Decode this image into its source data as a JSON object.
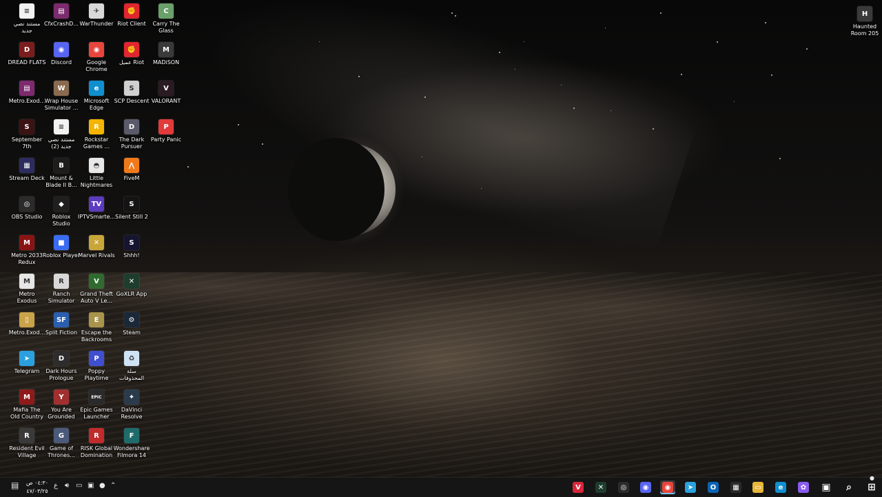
{
  "desktop": {
    "icons": [
      {
        "label": "مستند نصي\nجديد",
        "icon": "text-document-icon",
        "color": "#f2f2f2",
        "glyph": "≡"
      },
      {
        "label": "DREAD FLATS",
        "icon": "game-icon",
        "color": "#7b1d1d",
        "glyph": "D"
      },
      {
        "label": "Metro.Exod...",
        "icon": "winrar-archive-icon",
        "color": "#7d2a6e",
        "glyph": "▤"
      },
      {
        "label": "September\n7th",
        "icon": "game-icon",
        "color": "#3c1313",
        "glyph": "S"
      },
      {
        "label": "Stream Deck",
        "icon": "stream-deck-icon",
        "color": "#2c2c5e",
        "glyph": "▦"
      },
      {
        "label": "OBS Studio",
        "icon": "obs-icon",
        "color": "#2b2b2b",
        "glyph": "◎"
      },
      {
        "label": "Metro 2033\nRedux",
        "icon": "game-icon",
        "color": "#8a1414",
        "glyph": "M"
      },
      {
        "label": "Metro\nExodus",
        "icon": "game-icon",
        "color": "#e6e6e6",
        "glyph": "M"
      },
      {
        "label": "Metro.Exod...",
        "icon": "document-icon",
        "color": "#c9a24a",
        "glyph": "▯"
      },
      {
        "label": "Telegram",
        "icon": "telegram-icon",
        "color": "#2aa1de",
        "glyph": "➤"
      },
      {
        "label": "Mafia The\nOld Country",
        "icon": "game-icon",
        "color": "#8e1a1a",
        "glyph": "M"
      },
      {
        "label": "Resident Evil\nVillage",
        "icon": "game-icon",
        "color": "#3a3a3a",
        "glyph": "R"
      },
      {
        "label": "CfxCrashD...",
        "icon": "winrar-archive-icon",
        "color": "#7d2a6e",
        "glyph": "▤"
      },
      {
        "label": "Discord",
        "icon": "discord-icon",
        "color": "#5865f2",
        "glyph": "◉"
      },
      {
        "label": "Wrap House\nSimulator ...",
        "icon": "game-icon",
        "color": "#8a6b4f",
        "glyph": "W"
      },
      {
        "label": "مستند نصي\n(2) جديد",
        "icon": "text-document-icon",
        "color": "#f2f2f2",
        "glyph": "≡"
      },
      {
        "label": "Mount &\nBlade II B...",
        "icon": "game-icon",
        "color": "#1d1d1d",
        "glyph": "B"
      },
      {
        "label": "Roblox\nStudio",
        "icon": "roblox-studio-icon",
        "color": "#1f1f1f",
        "glyph": "◆"
      },
      {
        "label": "Roblox Player",
        "icon": "roblox-icon",
        "color": "#3a6cf0",
        "glyph": "■"
      },
      {
        "label": "Ranch\nSimulator",
        "icon": "game-icon",
        "color": "#d8d8d8",
        "glyph": "R"
      },
      {
        "label": "Split Fiction",
        "icon": "game-icon",
        "color": "#2a5fb0",
        "glyph": "SF"
      },
      {
        "label": "Dark Hours\nPrologue",
        "icon": "game-icon",
        "color": "#2d2d2d",
        "glyph": "D"
      },
      {
        "label": "You Are\nGrounded",
        "icon": "game-icon",
        "color": "#a03030",
        "glyph": "Y"
      },
      {
        "label": "Game of\nThrones...",
        "icon": "game-icon",
        "color": "#4b5a7a",
        "glyph": "G"
      },
      {
        "label": "WarThunder",
        "icon": "war-thunder-icon",
        "color": "#d9d9d9",
        "glyph": "✈"
      },
      {
        "label": "Google\nChrome",
        "icon": "chrome-icon",
        "color": "#e8453c",
        "glyph": "◉"
      },
      {
        "label": "Microsoft\nEdge",
        "icon": "edge-icon",
        "color": "#0f8fcf",
        "glyph": "e"
      },
      {
        "label": "Rockstar\nGames ...",
        "icon": "rockstar-icon",
        "color": "#f4b400",
        "glyph": "R"
      },
      {
        "label": "Little\nNightmares",
        "icon": "game-icon",
        "color": "#e8e8e8",
        "glyph": "◓"
      },
      {
        "label": "IPTVSmarte...",
        "icon": "iptv-icon",
        "color": "#5c3bbf",
        "glyph": "TV"
      },
      {
        "label": "Marvel Rivals",
        "icon": "game-icon",
        "color": "#c9a63a",
        "glyph": "✕"
      },
      {
        "label": "Grand Theft\nAuto V Le...",
        "icon": "game-icon",
        "color": "#2f6b2f",
        "glyph": "V"
      },
      {
        "label": "Escape the\nBackrooms",
        "icon": "game-icon",
        "color": "#a8944a",
        "glyph": "E"
      },
      {
        "label": "Poppy\nPlaytime",
        "icon": "game-icon",
        "color": "#3f4fcf",
        "glyph": "P"
      },
      {
        "label": "Epic Games\nLauncher",
        "icon": "epic-games-icon",
        "color": "#2a2a2a",
        "glyph": "EPIC"
      },
      {
        "label": "RISK Global\nDomination",
        "icon": "game-icon",
        "color": "#c22b2b",
        "glyph": "R"
      },
      {
        "label": "Riot Client",
        "icon": "riot-icon",
        "color": "#e0262f",
        "glyph": "✊"
      },
      {
        "label": "عميل Riot",
        "icon": "riot-icon",
        "color": "#e0262f",
        "glyph": "✊"
      },
      {
        "label": "SCP Descent",
        "icon": "game-icon",
        "color": "#d0d0d0",
        "glyph": "S"
      },
      {
        "label": "The Dark\nPursuer",
        "icon": "game-icon",
        "color": "#5a5a6a",
        "glyph": "D"
      },
      {
        "label": "FiveM",
        "icon": "fivem-icon",
        "color": "#f07a1a",
        "glyph": "⋀"
      },
      {
        "label": "Silent Still 2",
        "icon": "game-icon",
        "color": "#141414",
        "glyph": "S"
      },
      {
        "label": "Shhh!",
        "icon": "game-icon",
        "color": "#151530",
        "glyph": "S"
      },
      {
        "label": "GoXLR App",
        "icon": "goxlr-icon",
        "color": "#1e3d2e",
        "glyph": "✕"
      },
      {
        "label": "Steam",
        "icon": "steam-icon",
        "color": "#1b2838",
        "glyph": "⚙"
      },
      {
        "label": "سلة\nالمحذوفات",
        "icon": "recycle-bin-icon",
        "color": "#cfe3f5",
        "glyph": "♻"
      },
      {
        "label": "DaVinci\nResolve",
        "icon": "davinci-resolve-icon",
        "color": "#2b3b4b",
        "glyph": "✦"
      },
      {
        "label": "Wondershare\nFilmora 14",
        "icon": "filmora-icon",
        "color": "#1f6b6b",
        "glyph": "F"
      },
      {
        "label": "Carry The\nGlass",
        "icon": "game-icon",
        "color": "#6aa06a",
        "glyph": "C"
      },
      {
        "label": "MADiSON",
        "icon": "game-icon",
        "color": "#3a3a3a",
        "glyph": "M"
      },
      {
        "label": "VALORANT",
        "icon": "valorant-icon",
        "color": "#2a1a22",
        "glyph": "V"
      },
      {
        "label": "Party Panic",
        "icon": "game-icon",
        "color": "#e23a3a",
        "glyph": "P"
      }
    ],
    "right_icon": {
      "label": "Haunted\nRoom  205",
      "icon": "game-icon",
      "color": "#3a3a3a",
      "glyph": "H"
    }
  },
  "taskbar": {
    "clock": {
      "time": "٠٤:٣٠ ص",
      "date": "٤٧/٠٣/٢٥"
    },
    "language": "ع",
    "apps": [
      {
        "name": "valorant-taskbar-icon",
        "color": "#d8263a",
        "glyph": "V"
      },
      {
        "name": "goxlr-taskbar-icon",
        "color": "#1e3d2e",
        "glyph": "✕"
      },
      {
        "name": "obs-taskbar-icon",
        "color": "#2b2b2b",
        "glyph": "◎"
      },
      {
        "name": "discord-taskbar-icon",
        "color": "#5865f2",
        "glyph": "◉"
      },
      {
        "name": "chrome-taskbar-icon",
        "color": "#e8453c",
        "glyph": "◉",
        "active": true
      },
      {
        "name": "telegram-taskbar-icon",
        "color": "#2aa1de",
        "glyph": "➤"
      },
      {
        "name": "outlook-taskbar-icon",
        "color": "#0a64b4",
        "glyph": "O"
      },
      {
        "name": "microsoft-store-taskbar-icon",
        "color": "#2a2a2a",
        "glyph": "▦"
      },
      {
        "name": "file-explorer-taskbar-icon",
        "color": "#e8b73a",
        "glyph": "▭"
      },
      {
        "name": "edge-taskbar-icon",
        "color": "#0f8fcf",
        "glyph": "e"
      },
      {
        "name": "copilot-taskbar-icon",
        "color": "#8a5cf0",
        "glyph": "✿"
      },
      {
        "name": "task-view-taskbar-icon",
        "color": "#151515",
        "glyph": "▣"
      },
      {
        "name": "search-taskbar-icon",
        "color": "#151515",
        "glyph": "⌕"
      },
      {
        "name": "start-menu-taskbar-icon",
        "color": "#151515",
        "glyph": "⊞"
      }
    ]
  }
}
